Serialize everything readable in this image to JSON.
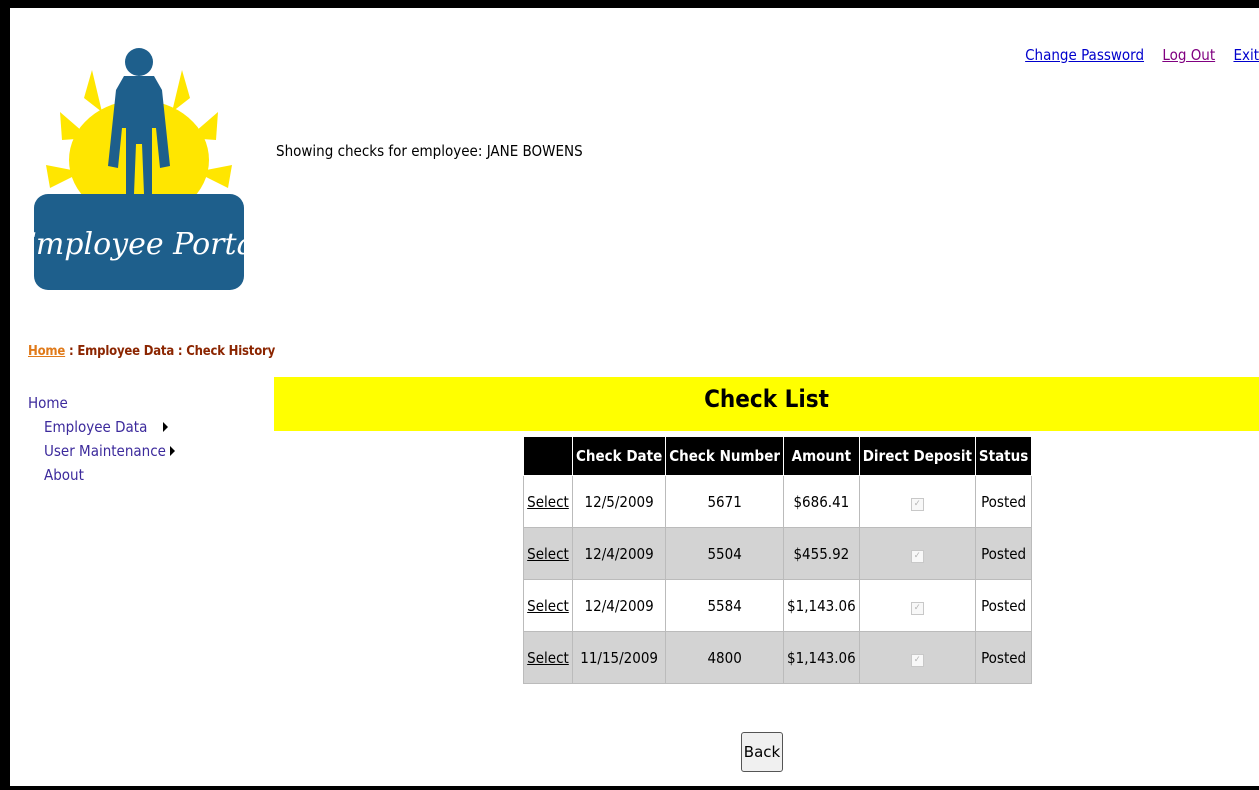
{
  "header": {
    "links": [
      "Change Password",
      "Log Out",
      "Exit"
    ],
    "logo_text": "Employee Portal",
    "showing_text": "Showing checks for employee: JANE BOWENS"
  },
  "breadcrumb": {
    "home": "Home",
    "separator": " : ",
    "section": "Employee Data",
    "page": "Check History"
  },
  "menu": {
    "home": "Home",
    "items": [
      "Employee Data",
      "User Maintenance",
      "About"
    ]
  },
  "check_list": {
    "title": "Check List",
    "columns": [
      "",
      "Check Date",
      "Check Number",
      "Amount",
      "Direct Deposit",
      "Status"
    ],
    "rows": [
      {
        "action": "Select",
        "date": "12/5/2009",
        "number": "5671",
        "amount": "$686.41",
        "direct_deposit": true,
        "status": "Posted"
      },
      {
        "action": "Select",
        "date": "12/4/2009",
        "number": "5504",
        "amount": "$455.92",
        "direct_deposit": true,
        "status": "Posted"
      },
      {
        "action": "Select",
        "date": "12/4/2009",
        "number": "5584",
        "amount": "$1,143.06",
        "direct_deposit": true,
        "status": "Posted"
      },
      {
        "action": "Select",
        "date": "11/15/2009",
        "number": "4800",
        "amount": "$1,143.06",
        "direct_deposit": true,
        "status": "Posted"
      }
    ]
  },
  "back_label": "Back",
  "colors": {
    "banner": "#ffff00",
    "logo_blue": "#1e5f8c",
    "logo_sun": "#ffe600",
    "menu_text": "#3c2a9c"
  }
}
